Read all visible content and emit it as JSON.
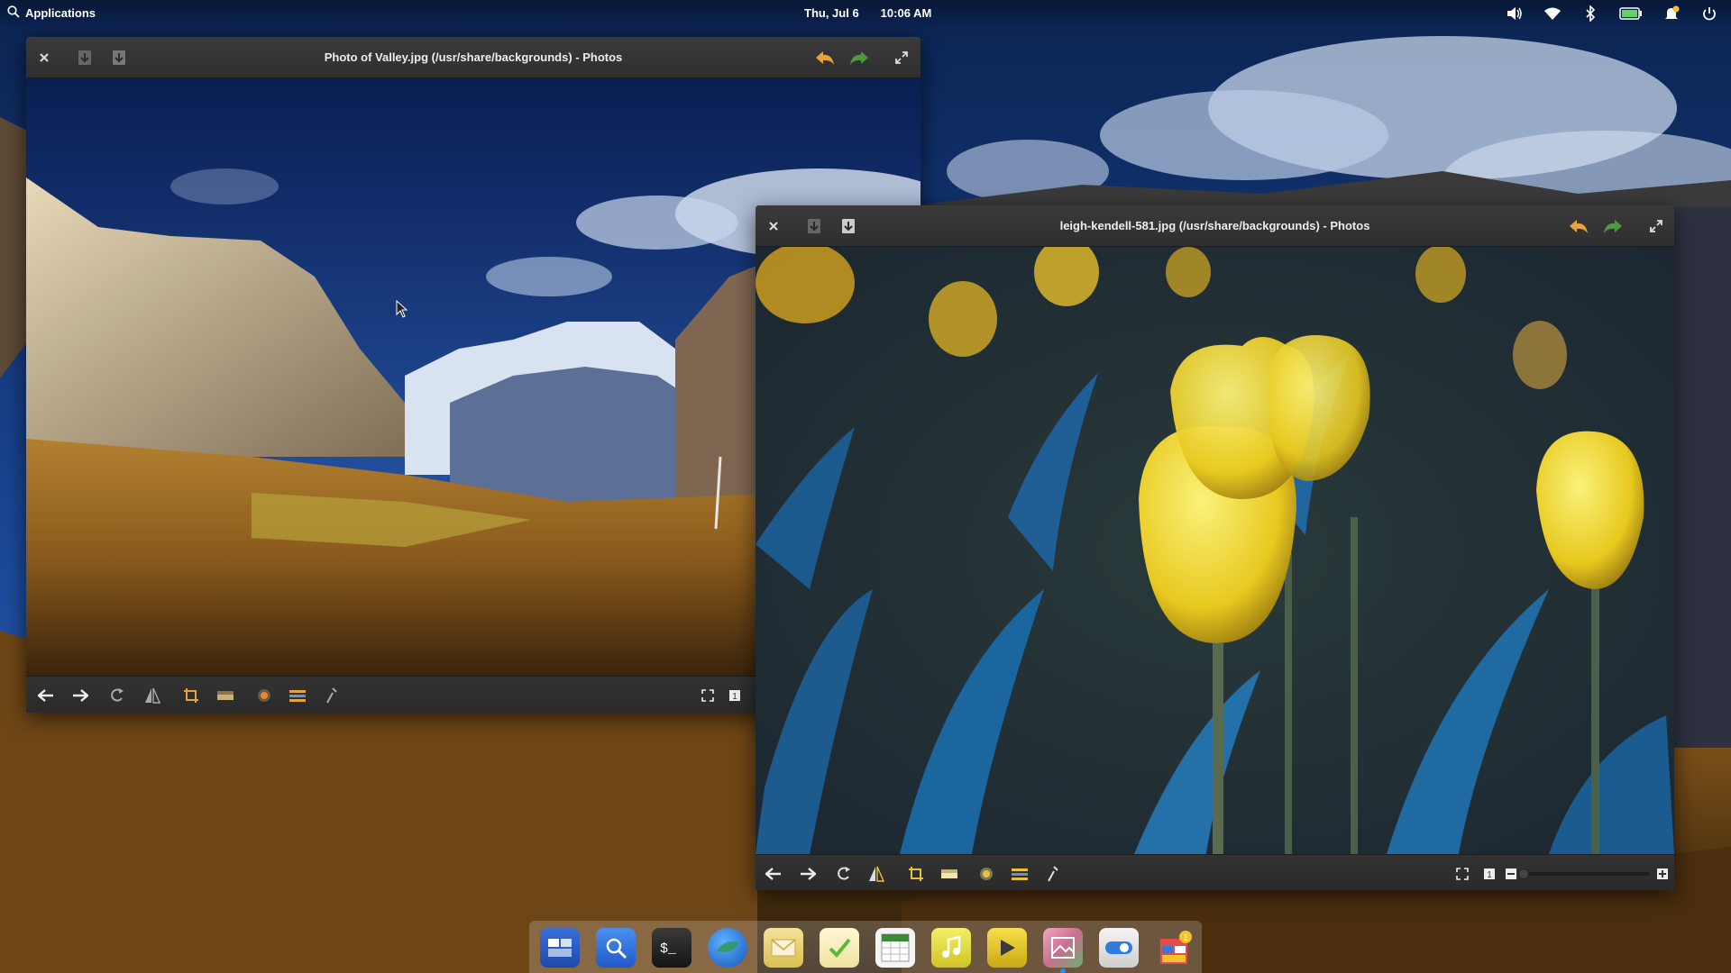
{
  "panel": {
    "applications_label": "Applications",
    "date": "Thu, Jul 6",
    "time": "10:06 AM",
    "indicators": [
      "volume-icon",
      "wifi-icon",
      "bluetooth-icon",
      "battery-icon",
      "notifications-icon",
      "power-icon"
    ]
  },
  "window_valley": {
    "title": "Photo of Valley.jpg (/usr/share/backgrounds) - Photos",
    "toolbar_icons": [
      "back-arrow-icon",
      "forward-arrow-icon",
      "rotate-icon",
      "flip-icon",
      "crop-icon",
      "straighten-icon",
      "redeye-icon",
      "adjust-icon",
      "enhance-icon"
    ]
  },
  "window_tulips": {
    "title": "leigh-kendell-581.jpg (/usr/share/backgrounds) - Photos",
    "toolbar_icons": [
      "back-arrow-icon",
      "forward-arrow-icon",
      "rotate-icon",
      "flip-icon",
      "crop-icon",
      "straighten-icon",
      "redeye-icon",
      "adjust-icon",
      "enhance-icon"
    ],
    "zoom_level": 0
  },
  "dock": {
    "apps": [
      "multitasking-view",
      "files",
      "terminal",
      "web-browser",
      "mail",
      "tasks",
      "calendar",
      "music",
      "videos",
      "photos",
      "system-settings",
      "appcenter"
    ],
    "running_app": "photos"
  },
  "colors": {
    "accent": "#1e90ff",
    "panel_text": "#ffffff",
    "titlebar": "#2f2f2f",
    "arrow_orange": "#e8a33a",
    "arrow_green": "#4d9a3a"
  }
}
